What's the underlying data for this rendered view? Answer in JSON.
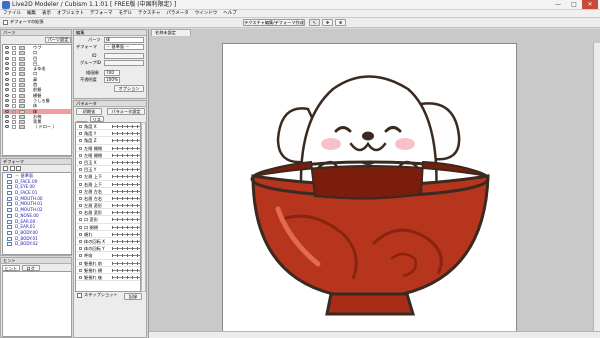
{
  "window": {
    "title": "Live2D Modeler / Cubism 1.1.01 [ FREE版 (中国利限定) ]",
    "min": "—",
    "max": "□",
    "close": "✕"
  },
  "menu": [
    "ファイル",
    "編集",
    "表示",
    "オブジェクト",
    "デフォーマ",
    "モデル",
    "テクスチャ",
    "パラメータ",
    "ウインドウ",
    "ヘルプ"
  ],
  "toolbar": {
    "deformer_expand": "デフォーマの拡張",
    "texture_edit": "テクスチャ編集/デフォーマ作成"
  },
  "parts": {
    "header": "パーツ",
    "settings_btn": "パーツ設定",
    "items": [
      "ウブ",
      "口",
      "目",
      "目_",
      "まゆ毛",
      "口",
      "鼻",
      "首",
      "前髪",
      "横髪",
      "うしろ髪",
      "体",
      "体",
      "お椀",
      "背景",
      "（ ドロー ）"
    ],
    "selected_index": 12
  },
  "deformer": {
    "header": "デフォーマ",
    "items": [
      "－ 基準面",
      "D_FACE.00",
      "D_EYE.00",
      "D_FACE.01",
      "D_MOUTH.00",
      "D_MOUTH.01",
      "D_MOUTH.02",
      "D_NOSE.00",
      "D_EAR.00",
      "D_EAR.01",
      "D_BODY.00",
      "D_BODY.01",
      "D_BODY.02"
    ]
  },
  "hint": {
    "header": "ヒント",
    "tabs": [
      "ヒント",
      "ログ"
    ]
  },
  "edit": {
    "header": "編集",
    "part_label": "パーツ",
    "part_value": "体",
    "deformer_label": "デフォーマ",
    "deformer_value": "－ 基準面 －",
    "id_label": "ID",
    "id_value": "",
    "group_label": "グループID",
    "group_value": "",
    "blend_label": "描画順",
    "blend_value": "700",
    "opacity_label": "不透明度",
    "opacity_value": "100%",
    "option_btn": "オプション"
  },
  "params": {
    "header": "パラメータ",
    "init_btn": "初期化",
    "settings_btn": "パラメータ設定",
    "tabs": [
      "値",
      "リスト"
    ],
    "items": [
      "角度 X",
      "角度 Y",
      "角度 Z",
      "左眼 開閉",
      "左眼 開閉",
      "目玉 X",
      "目玉 Y",
      "左眉 上下",
      "右眉 上下",
      "左眉 左右",
      "右眉 左右",
      "左眉 変形",
      "右眉 変形",
      "口 変形",
      "口 開閉",
      "頬れ",
      "体の回転 X",
      "体の回転 Y",
      "呼吸",
      "髪揺れ 前",
      "髪揺れ 横",
      "髪揺れ 後"
    ],
    "footer_check": "ステップショット",
    "footer_btn": "記録"
  },
  "canvas": {
    "tab": "名称未設定"
  },
  "colors": {
    "bowl": "#b8351d",
    "bowl_dark": "#7a1d0c",
    "selected": "#f29c9c"
  }
}
